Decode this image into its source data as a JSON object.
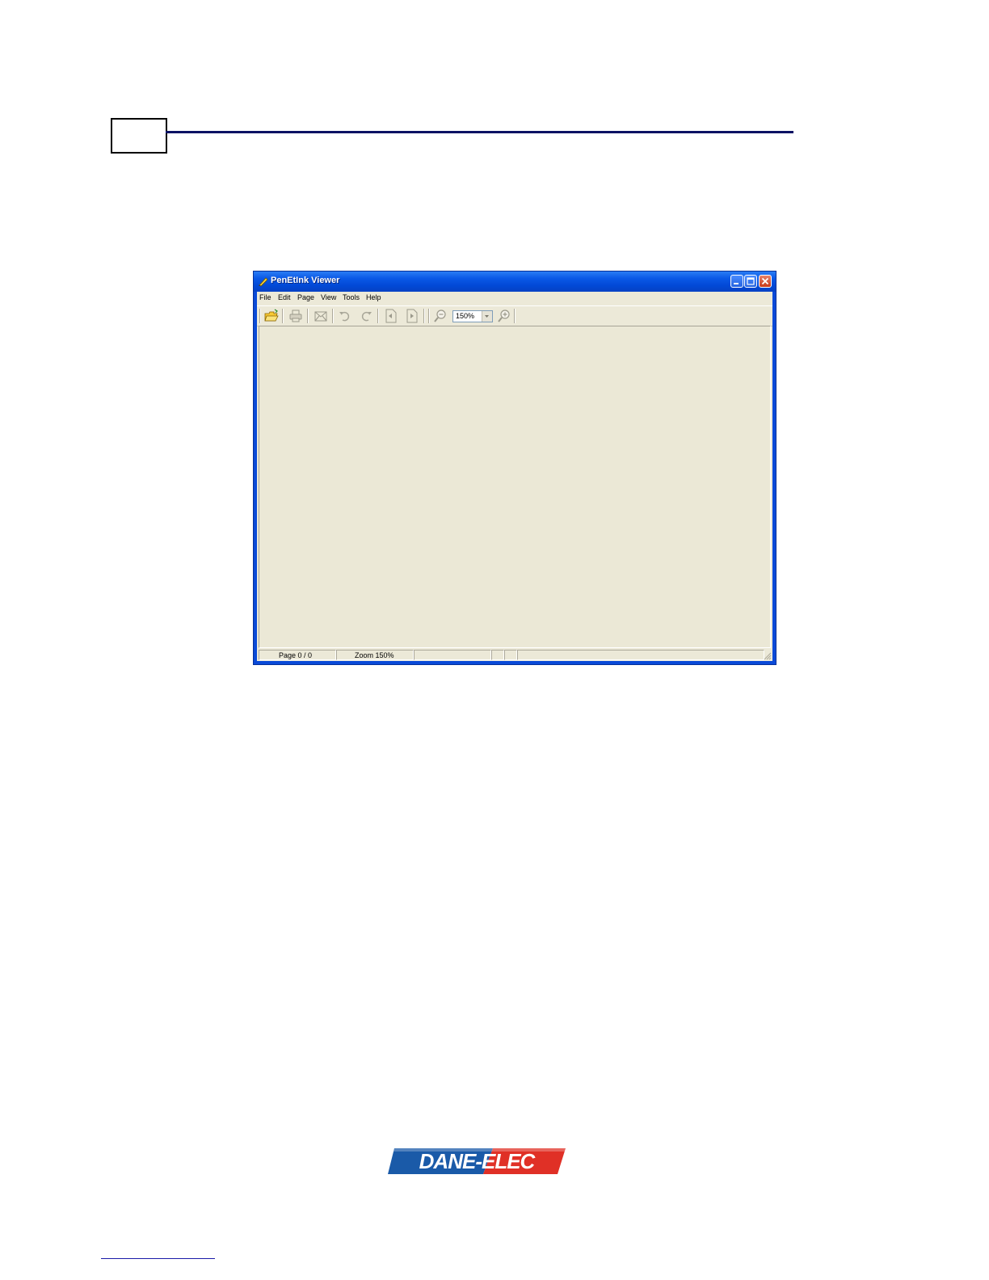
{
  "window": {
    "title": "PenEtInk Viewer",
    "menu": [
      "File",
      "Edit",
      "Page",
      "View",
      "Tools",
      "Help"
    ],
    "zoom_value": "150%",
    "status": {
      "page": "Page 0 / 0",
      "zoom": "Zoom 150%"
    },
    "icons": [
      "open-folder-icon",
      "print-icon",
      "email-icon",
      "undo-icon",
      "redo-icon",
      "previous-page-icon",
      "next-page-icon",
      "zoom-out-icon",
      "zoom-in-icon"
    ]
  },
  "logo": {
    "text": "DANE-ELEC",
    "colors": {
      "left": "#1a5aa8",
      "right": "#e03026"
    }
  },
  "colors": {
    "header_rule": "#0b1264",
    "window_frame": "#0a4ad8",
    "client_bg": "#ece9d8"
  }
}
